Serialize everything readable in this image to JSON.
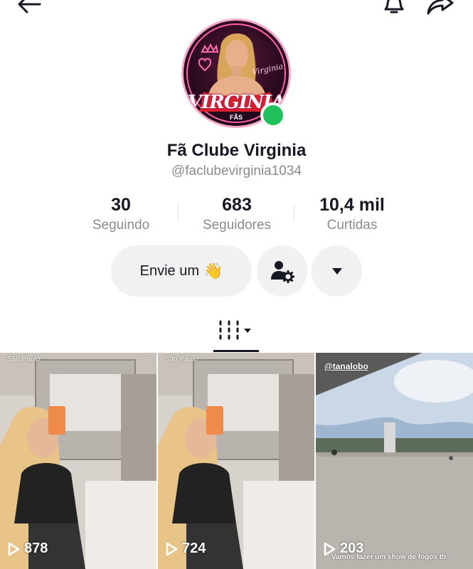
{
  "header": {
    "back_icon": "arrow-left-icon",
    "bell_icon": "bell-icon",
    "share_icon": "share-arrow-icon"
  },
  "profile": {
    "avatar_logo_text": "VIRGINIA",
    "avatar_logo_sub": "FÃS",
    "avatar_script": "Virginia",
    "online_color": "#20c05c",
    "name": "Fã Clube Virginia",
    "handle": "@faclubevirginia1034"
  },
  "stats": [
    {
      "value": "30",
      "label": "Seguindo"
    },
    {
      "value": "683",
      "label": "Seguidores"
    },
    {
      "value": "10,4 mil",
      "label": "Curtidas"
    }
  ],
  "actions": {
    "message_label": "Envie um",
    "message_emoji": "👋",
    "friends_icon": "person-settings-icon",
    "more_icon": "caret-down-icon"
  },
  "tabs": {
    "active_icon": "videos-grid-icon"
  },
  "videos": [
    {
      "location": "São Paulo",
      "views": "878"
    },
    {
      "location": "São Paulo",
      "views": "724"
    },
    {
      "mention": "@tanalobo",
      "views": "203",
      "caption": "Vamos fazer um show de fogos tb"
    }
  ],
  "colors": {
    "text_primary": "#161823",
    "text_secondary": "#8a8b91",
    "button_bg": "#f1f1f2"
  }
}
